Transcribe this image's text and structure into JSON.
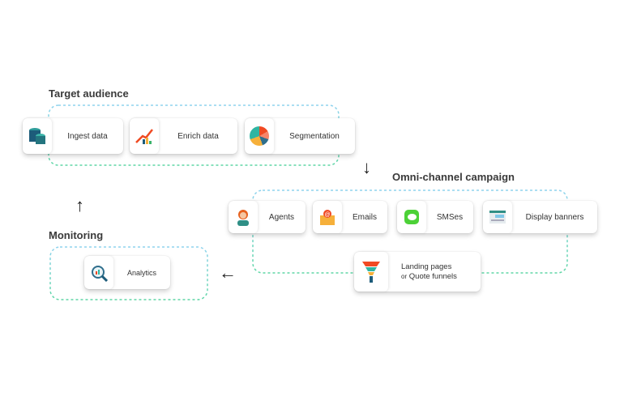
{
  "groups": {
    "target": {
      "title": "Target audience",
      "items": [
        "Ingest data",
        "Enrich data",
        "Segmentation"
      ]
    },
    "omni": {
      "title": "Omni-channel campaign",
      "items": [
        "Agents",
        "Emails",
        "SMSes",
        "Display banners"
      ],
      "landing_line1": "Landing pages",
      "landing_or": "or",
      "landing_line2": "Quote funnels"
    },
    "monitoring": {
      "title": "Monitoring",
      "items": [
        "Analytics"
      ]
    }
  },
  "colors": {
    "dash_top": "#8fd3ee",
    "dash_bottom": "#5fd6a6",
    "arrow": "#222222"
  }
}
